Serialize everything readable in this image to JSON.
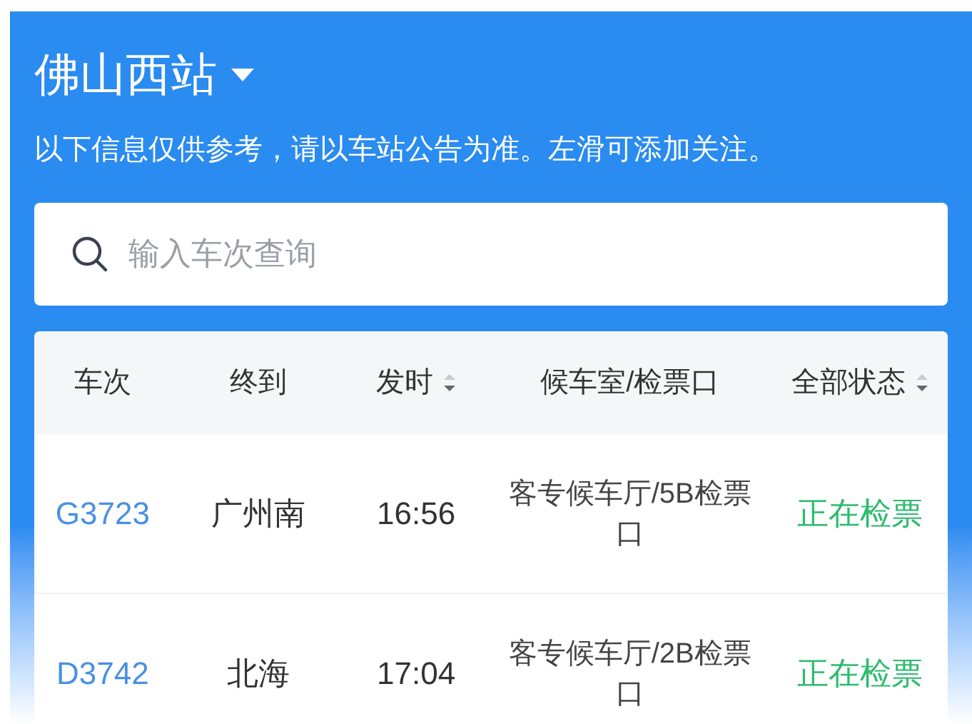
{
  "station": {
    "name": "佛山西站"
  },
  "notice": "以下信息仅供参考，请以车站公告为准。左滑可添加关注。",
  "search": {
    "placeholder": "输入车次查询"
  },
  "table": {
    "columns": [
      {
        "label": "车次",
        "sortable": false
      },
      {
        "label": "终到",
        "sortable": false
      },
      {
        "label": "发时",
        "sortable": true
      },
      {
        "label": "候车室/检票口",
        "sortable": false
      },
      {
        "label": "全部状态",
        "sortable": true
      }
    ],
    "rows": [
      {
        "train": "G3723",
        "destination": "广州南",
        "departs": "16:56",
        "gate": "客专候车厅/5B检票口",
        "status": "正在检票"
      },
      {
        "train": "D3742",
        "destination": "北海",
        "departs": "17:04",
        "gate": "客专候车厅/2B检票口",
        "status": "正在检票"
      }
    ]
  }
}
